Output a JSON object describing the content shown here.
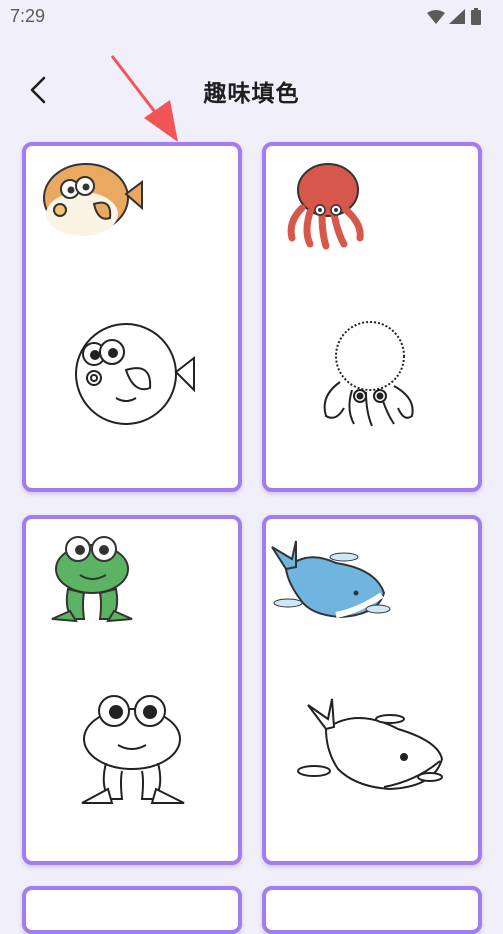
{
  "status_bar": {
    "time": "7:29"
  },
  "header": {
    "title": "趣味填色"
  },
  "cards": [
    {
      "subject": "pufferfish",
      "color": "#e9a960"
    },
    {
      "subject": "octopus",
      "color": "#d8574c"
    },
    {
      "subject": "frog",
      "color": "#5cb363"
    },
    {
      "subject": "whale",
      "color": "#6fb5e0"
    },
    {
      "subject": "partial-card-1"
    },
    {
      "subject": "partial-card-2"
    }
  ],
  "colors": {
    "accent": "#a07ef0",
    "background": "#f1eff9",
    "arrow": "#f25555"
  }
}
